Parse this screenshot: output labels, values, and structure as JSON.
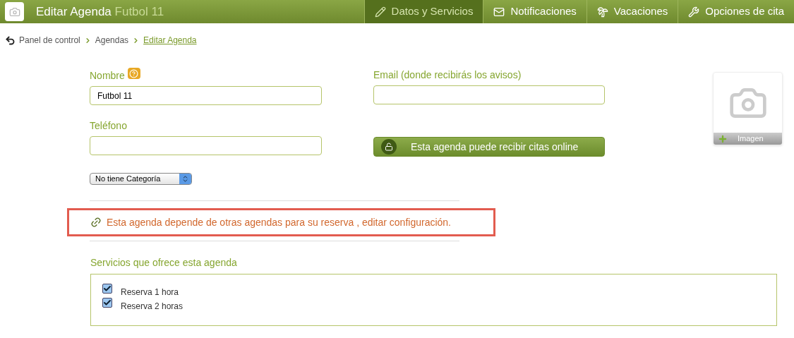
{
  "header": {
    "title": "Editar Agenda",
    "subtitle": "Futbol 11"
  },
  "tabs": [
    {
      "label": "Datos y Servicios",
      "kind": "pencil",
      "selected": true
    },
    {
      "label": "Notificaciones",
      "kind": "mail",
      "selected": false
    },
    {
      "label": "Vacaciones",
      "kind": "palm",
      "selected": false
    },
    {
      "label": "Opciones de cita",
      "kind": "tools",
      "selected": false
    }
  ],
  "breadcrumb": [
    {
      "label": "Panel de control",
      "current": false
    },
    {
      "label": "Agendas",
      "current": false
    },
    {
      "label": "Editar Agenda",
      "current": true
    }
  ],
  "form": {
    "name_label": "Nombre",
    "name_value": "Futbol 11",
    "phone_label": "Teléfono",
    "email_label": "Email (donde recibirás los avisos)",
    "online_button": "Esta agenda puede recibir citas online",
    "category": "No tiene Categoría"
  },
  "image_card": {
    "label": "Imagen"
  },
  "notice": "Esta agenda depende de otras agendas para su reserva , editar configuración.",
  "services": {
    "title": "Servicios que ofrece esta agenda",
    "items": [
      {
        "label": "Reserva 1 hora",
        "checked": true
      },
      {
        "label": "Reserva 2 horas",
        "checked": true
      }
    ]
  }
}
